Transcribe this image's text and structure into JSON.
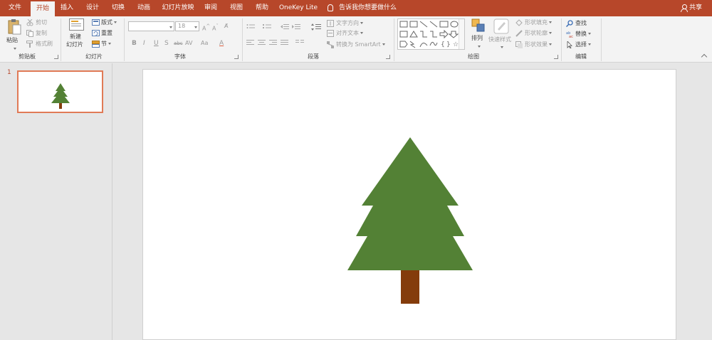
{
  "menu": {
    "tabs": [
      {
        "label": "文件"
      },
      {
        "label": "开始"
      },
      {
        "label": "插入"
      },
      {
        "label": "设计"
      },
      {
        "label": "切换"
      },
      {
        "label": "动画"
      },
      {
        "label": "幻灯片放映"
      },
      {
        "label": "审阅"
      },
      {
        "label": "视图"
      },
      {
        "label": "帮助"
      },
      {
        "label": "OneKey Lite"
      }
    ],
    "tell_me": "告诉我你想要做什么",
    "share": "共享"
  },
  "ribbon": {
    "clipboard": {
      "paste": "粘贴",
      "cut": "剪切",
      "copy": "复制",
      "format_painter": "格式刷",
      "label": "剪贴板"
    },
    "slides": {
      "new_slide_line1": "新建",
      "new_slide_line2": "幻灯片",
      "layout": "版式",
      "reset": "重置",
      "section": "节",
      "label": "幻灯片"
    },
    "font": {
      "font_name": "",
      "font_size": "18",
      "bold": "B",
      "italic": "I",
      "underline": "U",
      "shadow": "S",
      "strike": "abc",
      "spacing": "AV",
      "case": "Aa",
      "label": "字体"
    },
    "paragraph": {
      "text_direction": "文字方向",
      "align_text": "对齐文本",
      "smartart": "转换为 SmartArt",
      "label": "段落"
    },
    "drawing": {
      "arrange": "排列",
      "quick_styles": "快速样式",
      "shape_fill": "形状填充",
      "shape_outline": "形状轮廓",
      "shape_effects": "形状效果",
      "label": "绘图"
    },
    "editing": {
      "find": "查找",
      "replace": "替换",
      "select": "选择",
      "label": "编辑"
    }
  },
  "thumbnails": [
    {
      "number": "1"
    }
  ],
  "slide": {
    "tree_color": "#538135",
    "trunk_color": "#843c0c"
  }
}
